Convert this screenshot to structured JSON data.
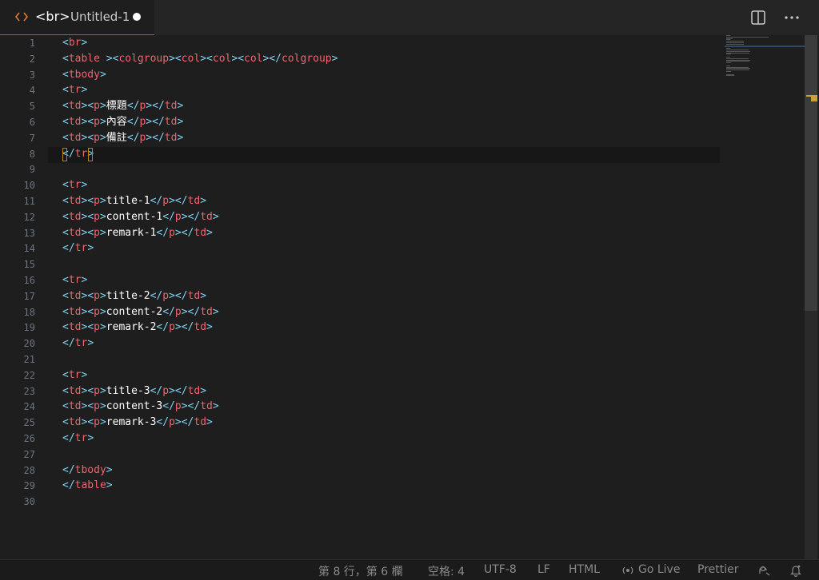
{
  "tab": {
    "icon": "code-brackets-icon",
    "name": "<br>",
    "file": "Untitled-1",
    "modified_indicator": "unsaved-dot"
  },
  "actions": {
    "split_icon": "split-editor-icon",
    "more_icon": "more-actions-icon"
  },
  "editor": {
    "line_numbers": [
      "1",
      "2",
      "3",
      "4",
      "5",
      "6",
      "7",
      "8",
      "9",
      "10",
      "11",
      "12",
      "13",
      "14",
      "15",
      "16",
      "17",
      "18",
      "19",
      "20",
      "21",
      "22",
      "23",
      "24",
      "25",
      "26",
      "27",
      "28",
      "29",
      "30"
    ],
    "current_line": 8,
    "lines": [
      "<br>",
      "<table ><colgroup><col><col><col></colgroup>",
      "<tbody>",
      "<tr>",
      "<td><p>標題</p></td>",
      "<td><p>內容</p></td>",
      "<td><p>備註</p></td>",
      "</tr>",
      "",
      "<tr>",
      "<td><p>title-1</p></td>",
      "<td><p>content-1</p></td>",
      "<td><p>remark-1</p></td>",
      "</tr>",
      "",
      "<tr>",
      "<td><p>title-2</p></td>",
      "<td><p>content-2</p></td>",
      "<td><p>remark-2</p></td>",
      "</tr>",
      "",
      "<tr>",
      "<td><p>title-3</p></td>",
      "<td><p>content-3</p></td>",
      "<td><p>remark-3</p></td>",
      "</tr>",
      "",
      "</tbody>",
      "</table>",
      ""
    ]
  },
  "status": {
    "position": "第 8 行，第 6 欄",
    "indent": "空格: 4",
    "encoding": "UTF-8",
    "eol": "LF",
    "language": "HTML",
    "golive": "Go Live",
    "prettier": "Prettier",
    "icons": {
      "golive": "broadcast-icon",
      "feedback": "feedback-icon",
      "bell": "bell-icon"
    }
  },
  "colors": {
    "tag": "#f0646e",
    "bracket": "#808080",
    "text": "#ffffff",
    "accent": "#2b8a8a"
  }
}
